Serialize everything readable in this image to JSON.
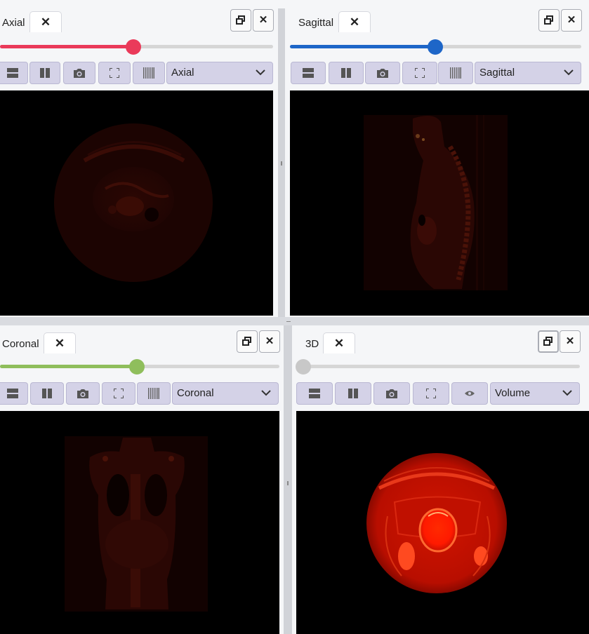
{
  "panels": {
    "axial": {
      "title": "Axial",
      "view_select": "Axial",
      "slider_fraction": 0.49,
      "accent": "#ea3a5a"
    },
    "sagittal": {
      "title": "Sagittal",
      "view_select": "Sagittal",
      "slider_fraction": 0.5,
      "accent": "#1e66c8"
    },
    "coronal": {
      "title": "Coronal",
      "view_select": "Coronal",
      "slider_fraction": 0.49,
      "accent": "#8fbe5c"
    },
    "threed": {
      "title": "3D",
      "view_select": "Volume",
      "slider_fraction": 0.0,
      "accent": "#c8c8c8"
    }
  },
  "icons": {
    "close": "✕",
    "restore": "🗗",
    "chevron": "⌄",
    "toolbar": [
      "layout-rows-icon",
      "layout-columns-icon",
      "camera-icon",
      "fullscreen-icon",
      "barcode-icon",
      "eye-icon"
    ]
  }
}
